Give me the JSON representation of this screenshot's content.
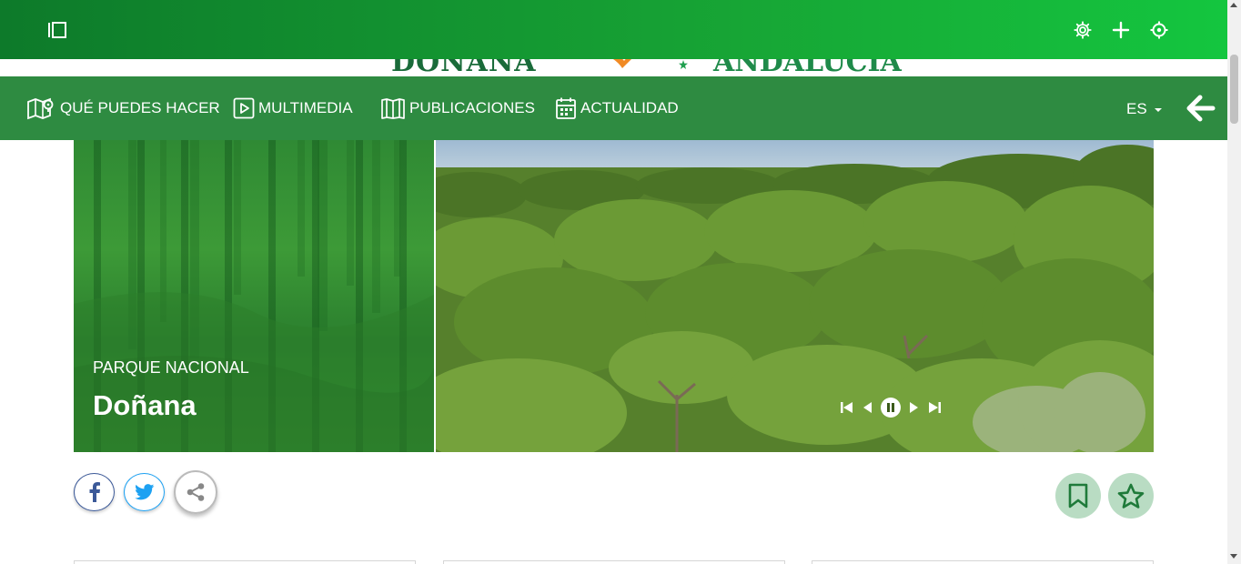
{
  "topbar": {
    "icons": [
      "sidebar-toggle-icon",
      "gear-icon",
      "plus-icon",
      "crosshair-icon"
    ],
    "gradient_colors": [
      "#0d7a2a",
      "#14c63f"
    ]
  },
  "nav": {
    "items": [
      {
        "label": "QUÉ PUEDES HACER",
        "icon": "map-pin-icon"
      },
      {
        "label": "MULTIMEDIA",
        "icon": "play-icon"
      },
      {
        "label": "PUBLICACIONES",
        "icon": "book-icon"
      },
      {
        "label": "ACTUALIDAD",
        "icon": "calendar-icon"
      }
    ],
    "language": "ES",
    "background": "#2e8b41"
  },
  "hero": {
    "kicker": "PARQUE NACIONAL",
    "title": "Doñana",
    "controls": [
      "first-icon",
      "prev-icon",
      "pause-icon",
      "next-icon",
      "last-icon"
    ]
  },
  "social": {
    "buttons": [
      "facebook-icon",
      "twitter-icon",
      "share-icon"
    ],
    "actions": [
      "bookmark-icon",
      "star-icon"
    ],
    "colors": {
      "facebook": "#3b5998",
      "twitter": "#1da1f2",
      "fav_bg": "#b9dcc3",
      "fav_icon": "#1f7a3a"
    }
  }
}
